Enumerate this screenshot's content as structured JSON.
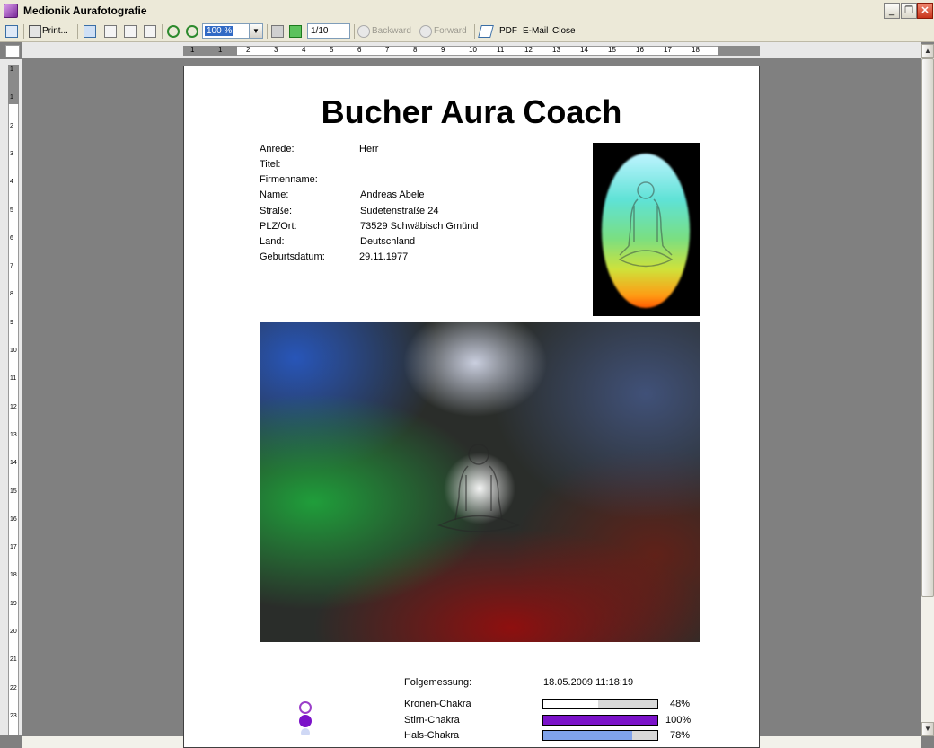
{
  "window": {
    "title": "Medionik Aurafotografie"
  },
  "toolbar": {
    "print": "Print...",
    "zoom": "100 %",
    "page": "1/10",
    "backward": "Backward",
    "forward": "Forward",
    "pdf": "PDF",
    "email": "E-Mail",
    "close": "Close"
  },
  "ruler": {
    "h": [
      "1",
      "1",
      "2",
      "3",
      "4",
      "5",
      "6",
      "7",
      "8",
      "9",
      "10",
      "11",
      "12",
      "13",
      "14",
      "15",
      "16",
      "17",
      "18"
    ],
    "v": [
      "1",
      "1",
      "2",
      "3",
      "4",
      "5",
      "6",
      "7",
      "8",
      "9",
      "10",
      "11",
      "12",
      "13",
      "14",
      "15",
      "16",
      "17",
      "18",
      "19",
      "20",
      "21",
      "22",
      "23"
    ]
  },
  "report": {
    "title": "Bucher Aura Coach",
    "fields": [
      {
        "label": "Anrede:",
        "value": "Herr"
      },
      {
        "label": "Titel:",
        "value": ""
      },
      {
        "label": "Firmenname:",
        "value": ""
      },
      {
        "label": "Name:",
        "value": "Andreas Abele"
      },
      {
        "label": "Straße:",
        "value": "Sudetenstraße 24"
      },
      {
        "label": "PLZ/Ort:",
        "value": "73529 Schwäbisch Gmünd"
      },
      {
        "label": "Land:",
        "value": "Deutschland"
      },
      {
        "label": "Geburtsdatum:",
        "value": "29.11.1977"
      }
    ],
    "measurement": {
      "label": "Folgemessung:",
      "value": "18.05.2009 11:18:19"
    },
    "chakras": [
      {
        "name": "Kronen-Chakra",
        "percent": "48%",
        "level": 0.48,
        "color": "#ffffff"
      },
      {
        "name": "Stirn-Chakra",
        "percent": "100%",
        "level": 1.0,
        "color": "#7b12c9"
      },
      {
        "name": "Hals-Chakra",
        "percent": "78%",
        "level": 0.78,
        "color": "#7fa2ea"
      }
    ]
  }
}
